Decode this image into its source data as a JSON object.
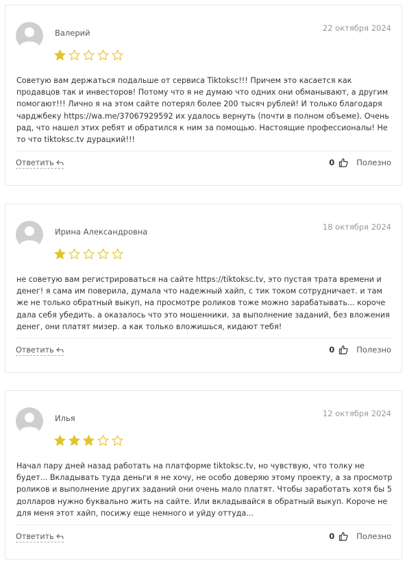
{
  "reviews": [
    {
      "author": "Валерий",
      "date": "22 октября 2024",
      "rating": 1,
      "text_before_link": "Советую вам держаться подальше от сервиса Tiktoksc!!! Причем это касается как продавцов так и инвесторов! Потому что я не думаю что одних они обманывают, а другим помогают!!! Лично я на этом сайте потерял более 200 тысяч рублей! И только благодаря чарджбеку ",
      "link": "https://wa.me/37067929592",
      "text_after_link": " их удалось вернуть (почти в полном объеме). Очень рад, что нашел этих ребят и обратился к ним за помощью. Настоящие профессионалы! Не то что tiktoksc.tv дурацкий!!!",
      "reply_label": "Ответить",
      "helpful_count": "0",
      "helpful_label": "Полезно"
    },
    {
      "author": "Ирина Александровна",
      "date": "18 октября 2024",
      "rating": 1,
      "text": "не советую вам регистрироваться на сайте https://tiktoksc.tv, это пустая трата времени и денег! я сама им поверила, думала что надежный хайп, с тик током сотрудничает. и там же не только обратный выкуп, на просмотре роликов тоже можно зарабатывать... короче дала себя убедить. а оказалось что это мошенники. за выполнение заданий, без вложения денег, они платят мизер. а как только вложишься, кидают тебя!",
      "reply_label": "Ответить",
      "helpful_count": "0",
      "helpful_label": "Полезно"
    },
    {
      "author": "Илья",
      "date": "12 октября 2024",
      "rating": 3,
      "text": "Начал пару дней назад работать на платформе tiktoksc.tv, но чувствую, что толку не будет... Вкладывать туда деньги я не хочу, не особо доверяю этому проекту, а за просмотр роликов и выполнение других заданий они очень мало платят. Чтобы заработать хотя бы 5 долларов нужно буквально жить на сайте. Или вкладывайся в обратный выкуп. Короче не для меня этот хайп, посижу еще немного и уйду оттуда...",
      "reply_label": "Ответить",
      "helpful_count": "0",
      "helpful_label": "Полезно"
    }
  ],
  "colors": {
    "star_filled": "#e2c52b",
    "star_empty": "#e2c52b",
    "avatar_bg": "#cfcfcf",
    "avatar_fg": "#ffffff"
  },
  "icons": {
    "avatar": "user-silhouette-icon",
    "star": "star-icon",
    "reply": "reply-arrow-icon",
    "helpful": "thumbs-up-icon"
  }
}
